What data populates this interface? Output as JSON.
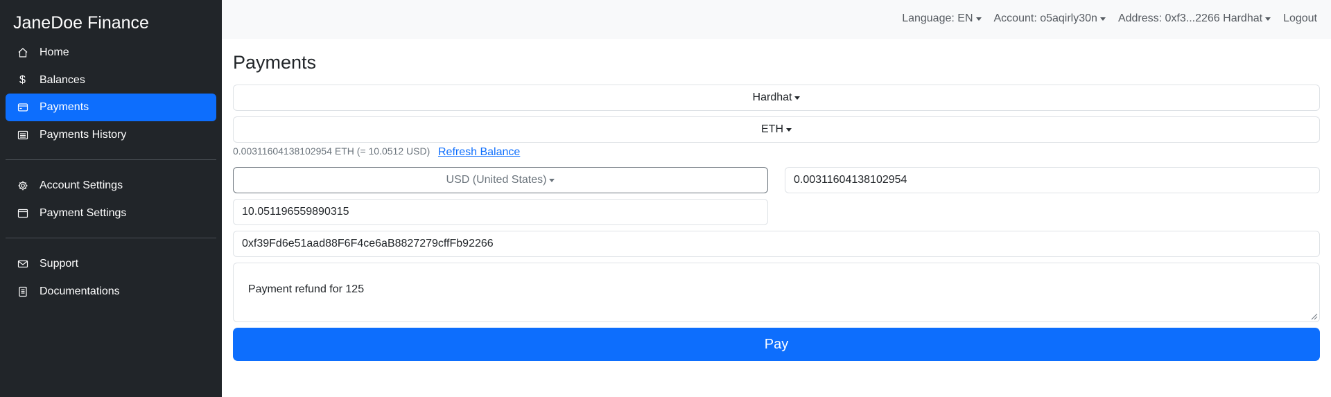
{
  "sidebar": {
    "brand": "JaneDoe Finance",
    "items": [
      {
        "label": "Home",
        "icon": "home-icon"
      },
      {
        "label": "Balances",
        "icon": "dollar-icon"
      },
      {
        "label": "Payments",
        "icon": "credit-card-icon",
        "active": true
      },
      {
        "label": "Payments History",
        "icon": "list-icon"
      },
      {
        "label": "Account Settings",
        "icon": "gear-icon"
      },
      {
        "label": "Payment Settings",
        "icon": "window-icon"
      },
      {
        "label": "Support",
        "icon": "envelope-icon"
      },
      {
        "label": "Documentations",
        "icon": "document-icon"
      }
    ]
  },
  "topbar": {
    "language": "Language: EN",
    "account": "Account: o5aqirly30n",
    "address": "Address: 0xf3...2266 Hardhat",
    "logout": "Logout"
  },
  "main": {
    "title": "Payments",
    "network": "Hardhat",
    "token": "ETH",
    "balance_text": "0.00311604138102954 ETH (= 10.0512 USD)",
    "refresh_label": "Refresh Balance",
    "currency": "USD (United States)",
    "token_amount": "0.00311604138102954",
    "fiat_amount": "10.051196559890315",
    "recipient_address": "0xf39Fd6e51aad88F6F4ce6aB8827279cffFb92266",
    "memo": "Payment refund for 125",
    "pay_label": "Pay"
  },
  "colors": {
    "sidebar_bg": "#212529",
    "accent": "#0d6efd",
    "topbar_bg": "#f8f9fa"
  }
}
